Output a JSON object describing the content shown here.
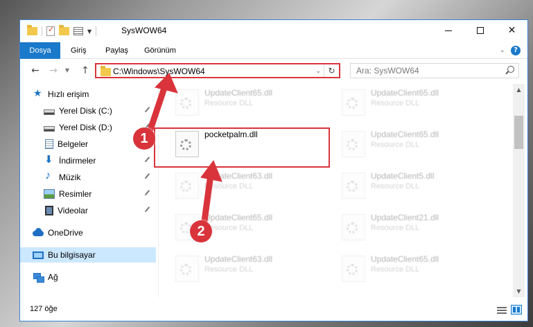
{
  "window": {
    "title": "SysWOW64",
    "controls": {
      "minimize": "minimize",
      "maximize": "maximize",
      "close": "✕"
    }
  },
  "ribbon": {
    "tabs": [
      "Dosya",
      "Giriş",
      "Paylaş",
      "Görünüm"
    ],
    "help": "?"
  },
  "address_bar": {
    "path": "C:\\Windows\\SysWOW64",
    "search_placeholder": "Ara: SysWOW64"
  },
  "nav": {
    "items": [
      {
        "label": "Hızlı erişim",
        "icon": "star-icon",
        "pinned": false
      },
      {
        "label": "Yerel Disk (C:)",
        "icon": "disk-icon",
        "pinned": true
      },
      {
        "label": "Yerel Disk (D:)",
        "icon": "disk-icon",
        "pinned": true
      },
      {
        "label": "Belgeler",
        "icon": "document-icon",
        "pinned": true
      },
      {
        "label": "İndirmeler",
        "icon": "download-icon",
        "pinned": true
      },
      {
        "label": "Müzik",
        "icon": "music-icon",
        "pinned": true
      },
      {
        "label": "Resimler",
        "icon": "pictures-icon",
        "pinned": true
      },
      {
        "label": "Videolar",
        "icon": "video-icon",
        "pinned": true
      },
      {
        "label": "OneDrive",
        "icon": "cloud-icon",
        "pinned": false
      },
      {
        "label": "Bu bilgisayar",
        "icon": "computer-icon",
        "pinned": false,
        "selected": true
      },
      {
        "label": "Ağ",
        "icon": "network-icon",
        "pinned": false
      }
    ]
  },
  "files": [
    {
      "name": "UpdateClient65.dll",
      "type": "Resource DLL",
      "faded": true
    },
    {
      "name": "UpdateClient65.dll",
      "type": "Resource DLL",
      "faded": true
    },
    {
      "name": "pocketpalm.dll",
      "type": "",
      "faded": false,
      "highlighted": true
    },
    {
      "name": "UpdateClient65.dll",
      "type": "Resource DLL",
      "faded": true
    },
    {
      "name": "UpdateClient63.dll",
      "type": "Resource DLL",
      "faded": true
    },
    {
      "name": "UpdateClient5.dll",
      "type": "Resource DLL",
      "faded": true
    },
    {
      "name": "UpdateClient65.dll",
      "type": "Resource DLL",
      "faded": true
    },
    {
      "name": "UpdateClient21.dll",
      "type": "Resource DLL",
      "faded": true
    },
    {
      "name": "UpdateClient63.dll",
      "type": "Resource DLL",
      "faded": true
    },
    {
      "name": "UpdateClient65.dll",
      "type": "Resource DLL",
      "faded": true
    }
  ],
  "status": {
    "count": "127 öğe"
  },
  "annotations": {
    "step1": "1",
    "step2": "2",
    "color": "#d9343c"
  }
}
